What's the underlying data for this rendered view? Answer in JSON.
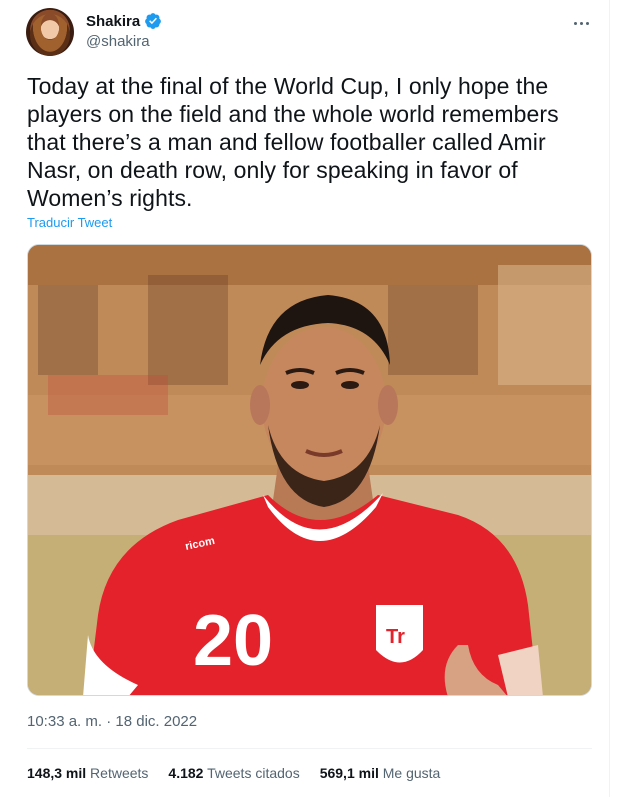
{
  "author": {
    "name": "Shakira",
    "handle": "@shakira",
    "verified": true
  },
  "tweet": {
    "text": "Today at the final of the World Cup, I only hope the players on the field and the whole world remembers that there’s a man and fellow footballer called Amir Nasr, on death row, only for speaking in favor of Women’s rights.",
    "translate_label": "Traducir Tweet",
    "timestamp": "10:33 a. m. · 18 dic. 2022"
  },
  "photo": {
    "shirt_number": "20",
    "shirt_brand": "ricom",
    "badge_text": "Tr"
  },
  "stats": {
    "retweets_count": "148,3 mil",
    "retweets_label": "Retweets",
    "quotes_count": "4.182",
    "quotes_label": "Tweets citados",
    "likes_count": "569,1 mil",
    "likes_label": "Me gusta"
  },
  "icons": {
    "verified": "verified-badge-icon",
    "more": "more-options-icon"
  },
  "colors": {
    "accent": "#1d9bf0",
    "secondary_text": "#536471",
    "primary_text": "#0f1419",
    "shirt_red": "#e3222b"
  }
}
